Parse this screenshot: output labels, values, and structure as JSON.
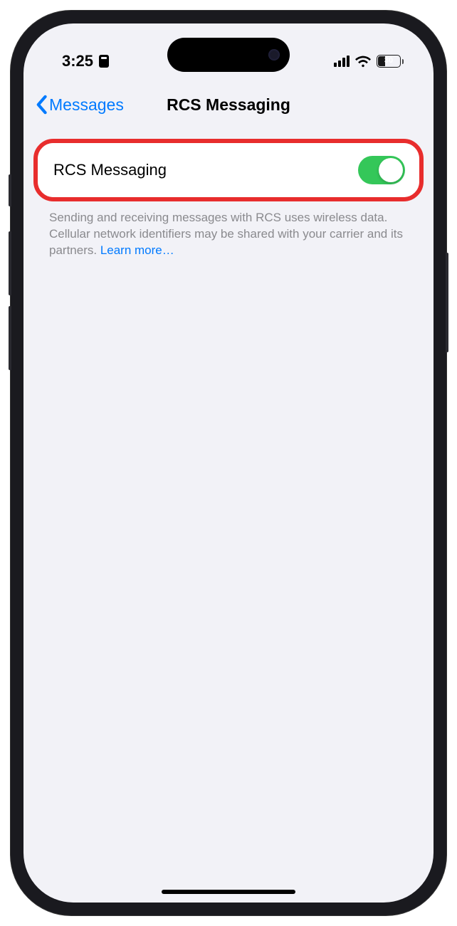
{
  "status": {
    "time": "3:25",
    "battery_level": "30"
  },
  "nav": {
    "back_label": "Messages",
    "title": "RCS Messaging"
  },
  "setting": {
    "label": "RCS Messaging",
    "toggle_on": true
  },
  "footer": {
    "description": "Sending and receiving messages with RCS uses wireless data. Cellular network identifiers may be shared with your carrier and its partners. ",
    "learn_more": "Learn more…"
  }
}
